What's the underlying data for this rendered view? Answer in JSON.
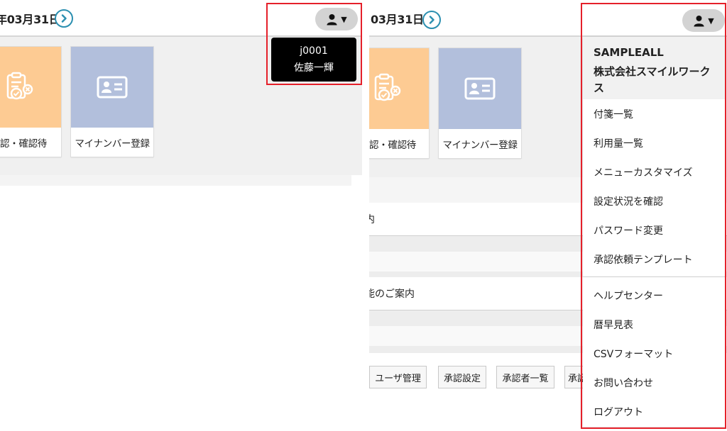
{
  "left": {
    "date": "年03月31日",
    "tooltip": {
      "user_id": "j0001",
      "user_name": "佐藤一輝"
    },
    "tiles": [
      {
        "label": "認・確認待",
        "icon": "clipboard-check-icon",
        "color": "#fdcb93"
      },
      {
        "label": "マイナンバー登録",
        "icon": "id-card-icon",
        "color": "#b2bfdc"
      }
    ]
  },
  "right": {
    "date": "03月31日",
    "tiles": [
      {
        "label": "認・確認待",
        "icon": "clipboard-check-icon",
        "color": "#fdcb93"
      },
      {
        "label": "マイナンバー登録",
        "icon": "id-card-icon",
        "color": "#b2bfdc"
      }
    ],
    "rows": [
      {
        "text": "内"
      },
      {
        "text": "能のご案内"
      }
    ],
    "footer_buttons": [
      "ユーザ管理",
      "承認設定",
      "承認者一覧",
      "承認"
    ],
    "dropdown": {
      "company_code": "SAMPLEALL",
      "company_name": "株式会社スマイルワークス",
      "items": [
        "付箋一覧",
        "利用量一覧",
        "メニューカスタマイズ",
        "設定状況を確認",
        "パスワード変更",
        "承認依頼テンプレート"
      ],
      "help_items": [
        "ヘルプセンター",
        "暦早見表",
        "CSVフォーマット",
        "お問い合わせ",
        "ログアウト"
      ]
    }
  },
  "icons": {
    "user_menu": "person-icon",
    "caret": "▼",
    "next": "chevron-right-icon"
  },
  "colors": {
    "accent": "#2b8fb0",
    "highlight": "#e5202a",
    "tile_orange": "#fdcb93",
    "tile_blue": "#b2bfdc"
  }
}
